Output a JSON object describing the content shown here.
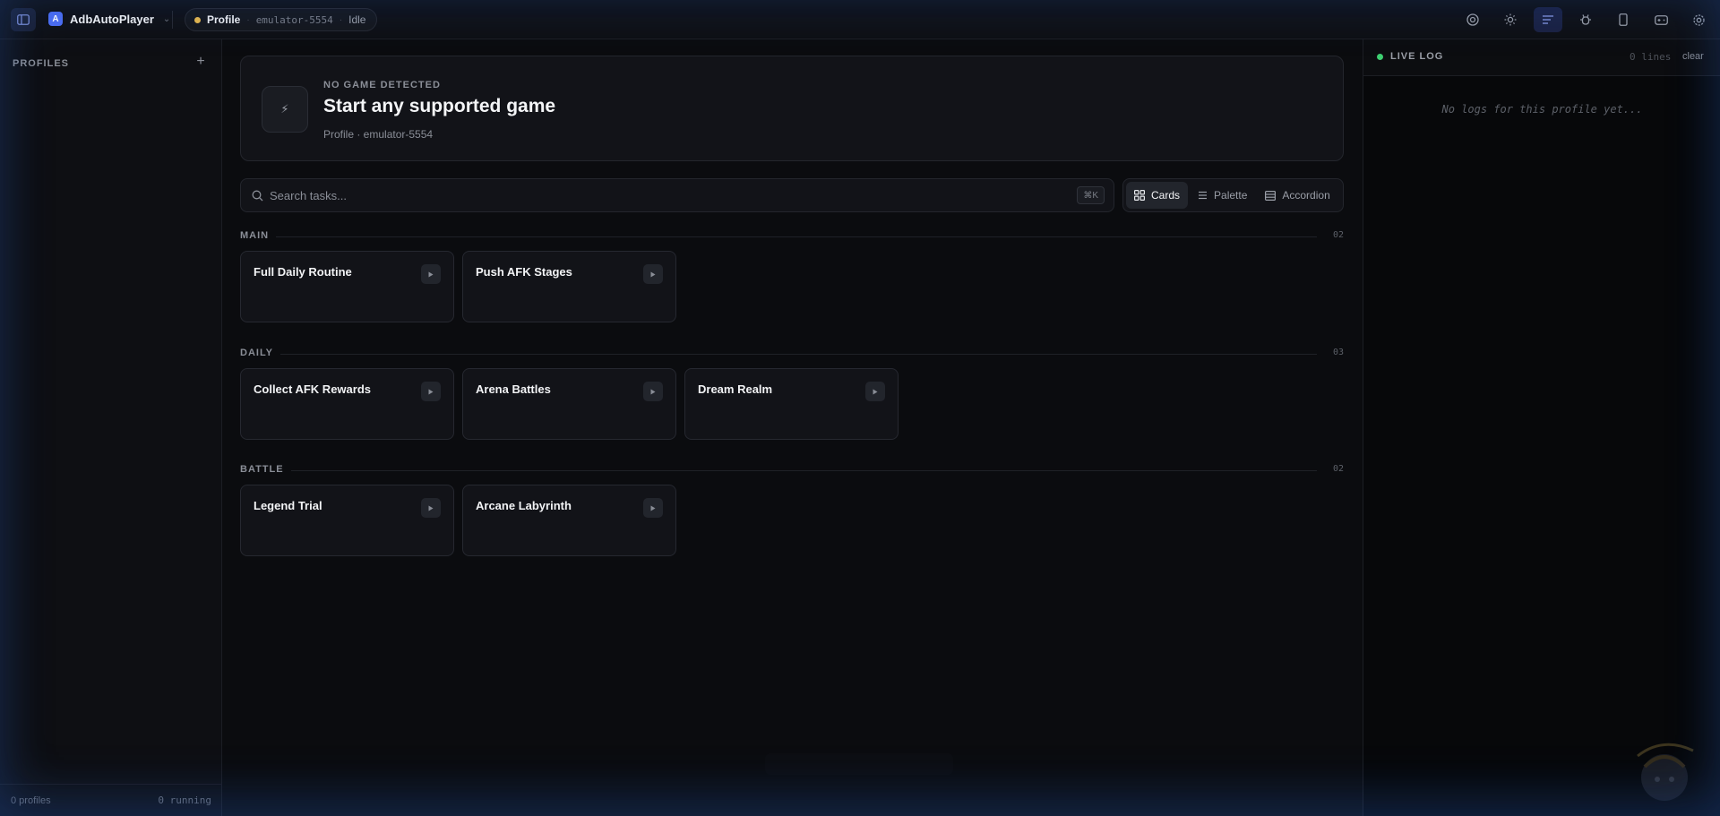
{
  "app": {
    "name": "AdbAutoPlayer",
    "logo_letter": "A",
    "chevron": "⌄"
  },
  "profile_pill": {
    "name": "Profile",
    "sep": "·",
    "device": "emulator-5554",
    "state": "Idle",
    "status_color": "#e8b84b"
  },
  "top_icons": [
    "target-icon",
    "sun-icon",
    "log-toggle-icon",
    "debug-icon",
    "phone-icon",
    "gamepad-icon",
    "settings-icon"
  ],
  "sidebar": {
    "title": "PROFILES",
    "add": "+",
    "footer_profiles": "0 profiles",
    "footer_running": "0 running"
  },
  "hero": {
    "eyebrow": "NO GAME DETECTED",
    "title": "Start any supported game",
    "subtitle": "Profile · emulator-5554",
    "icon": "⚡"
  },
  "search": {
    "placeholder": "Search tasks...",
    "shortcut": "⌘K"
  },
  "view_modes": {
    "cards": "Cards",
    "palette": "Palette",
    "accordion": "Accordion",
    "active": "Cards"
  },
  "sections": [
    {
      "label": "MAIN",
      "count": "02",
      "tasks": [
        "Full Daily Routine",
        "Push AFK Stages"
      ]
    },
    {
      "label": "DAILY",
      "count": "03",
      "tasks": [
        "Collect AFK Rewards",
        "Arena Battles",
        "Dream Realm"
      ]
    },
    {
      "label": "BATTLE",
      "count": "02",
      "tasks": [
        "Legend Trial",
        "Arcane Labyrinth"
      ]
    }
  ],
  "log": {
    "title": "LIVE LOG",
    "lines": "0 lines",
    "clear": "clear",
    "empty": "No logs for this profile yet...",
    "status_color": "#3ecf71"
  },
  "colors": {
    "accent": "#4c6ef5",
    "background": "#0b0c0f",
    "card": "#121318"
  }
}
